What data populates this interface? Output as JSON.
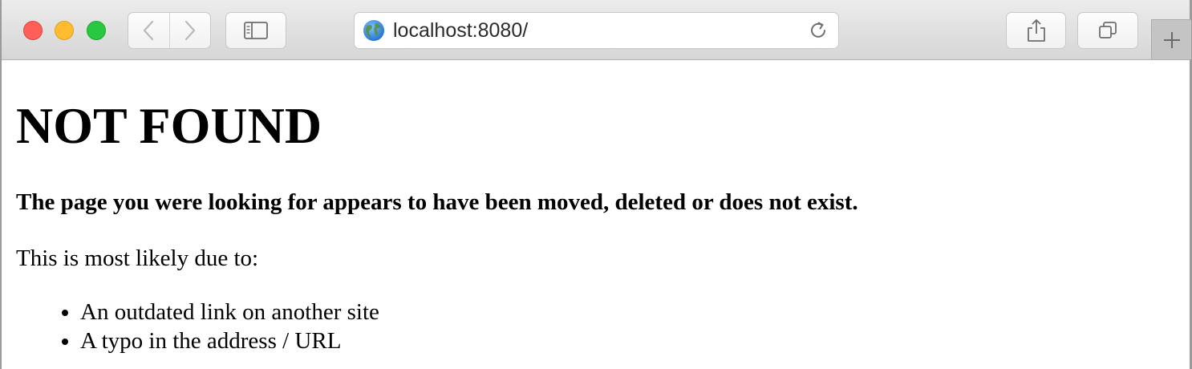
{
  "browser": {
    "address": {
      "url": "localhost:8080/",
      "site_icon": "globe-icon",
      "reload_icon": "reload-icon"
    },
    "toolbar_icons": {
      "back": "chevron-left-icon",
      "forward": "chevron-right-icon",
      "sidebar": "sidebar-icon",
      "share": "share-icon",
      "tabs": "tabs-overview-icon",
      "new_tab": "plus-icon"
    },
    "traffic_lights": {
      "close": "#ff5f57",
      "minimize": "#febc2e",
      "maximize": "#28c840"
    }
  },
  "page": {
    "heading": "NOT FOUND",
    "subtitle": "The page you were looking for appears to have been moved, deleted or does not exist.",
    "intro": "This is most likely due to:",
    "reasons": [
      "An outdated link on another site",
      "A typo in the address / URL"
    ]
  }
}
